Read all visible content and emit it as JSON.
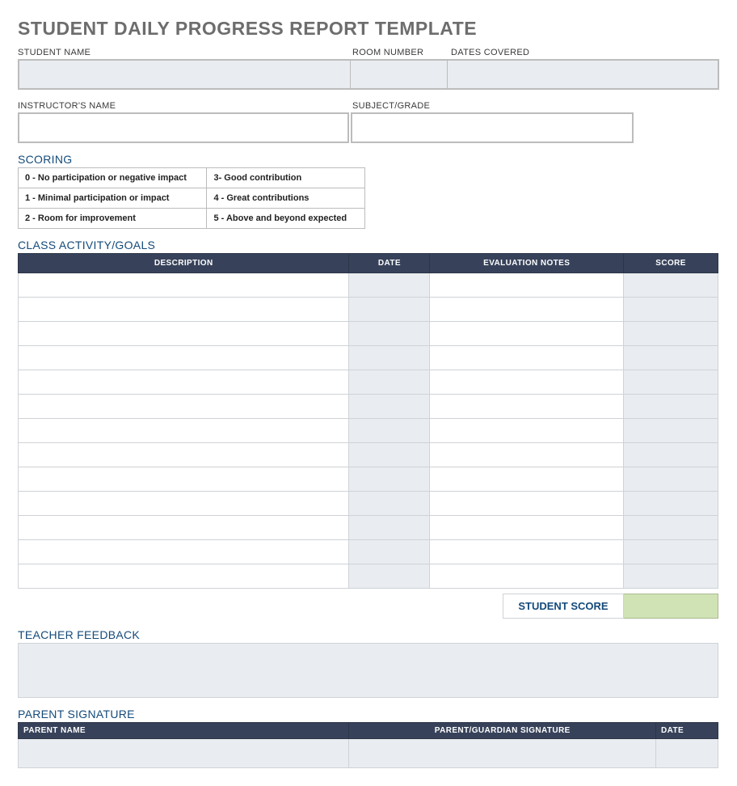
{
  "title": "STUDENT DAILY PROGRESS REPORT TEMPLATE",
  "labels": {
    "student_name": "STUDENT NAME",
    "room_number": "ROOM NUMBER",
    "dates_covered": "DATES COVERED",
    "instructor_name": "INSTRUCTOR'S NAME",
    "subject_grade": "SUBJECT/GRADE"
  },
  "sections": {
    "scoring": "SCORING",
    "activity": "CLASS ACTIVITY/GOALS",
    "feedback": "TEACHER FEEDBACK",
    "parent_sig": "PARENT SIGNATURE"
  },
  "scoring_legend": {
    "r0c0": "0 - No participation or negative impact",
    "r0c1": "3- Good contribution",
    "r1c0": "1 - Minimal participation or impact",
    "r1c1": "4 - Great contributions",
    "r2c0": "2 - Room for improvement",
    "r2c1": "5 - Above and beyond expected"
  },
  "activity_headers": {
    "description": "DESCRIPTION",
    "date": "DATE",
    "notes": "EVALUATION NOTES",
    "score": "SCORE"
  },
  "activity_rows": 13,
  "student_score_label": "STUDENT SCORE",
  "student_score_value": "",
  "parent_headers": {
    "name": "PARENT NAME",
    "signature": "PARENT/GUARDIAN SIGNATURE",
    "date": "DATE"
  },
  "fields": {
    "student_name": "",
    "room_number": "",
    "dates_covered": "",
    "instructor_name": "",
    "subject_grade": "",
    "teacher_feedback": "",
    "parent_name": "",
    "parent_signature": "",
    "parent_date": ""
  }
}
